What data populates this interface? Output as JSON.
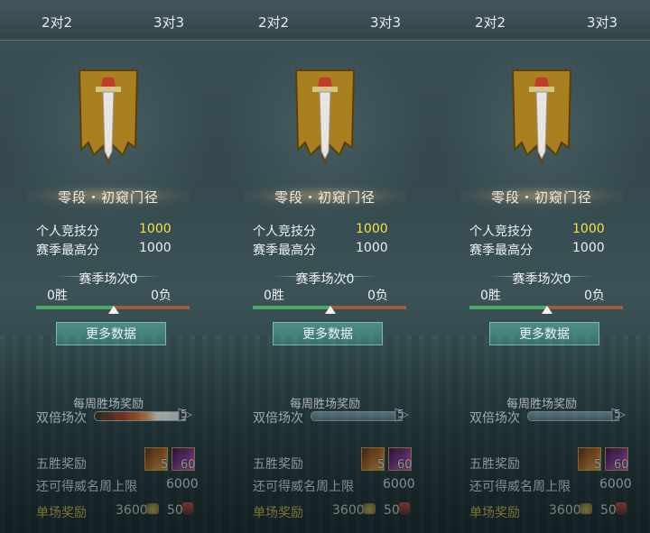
{
  "colors": {
    "gold_value": "#f4e14a",
    "reward_label": "#f2d34a",
    "win_bar": "#49a86a",
    "lose_bar": "#a05a3c"
  },
  "panels": [
    {
      "tabs": [
        {
          "label": "2对2",
          "active": false
        },
        {
          "label": "3对3",
          "active": false
        }
      ],
      "rank_name": "零段・初窥门径",
      "personal_score_label": "个人竞技分",
      "personal_score": "1000",
      "season_high_label": "赛季最高分",
      "season_high": "1000",
      "season_matches": "赛季场次0",
      "wins": "0胜",
      "losses": "0负",
      "more_data": "更多数据",
      "weekly_title": "每周胜场奖励",
      "double_label": "双倍场次",
      "double_count": "5",
      "five_wins_label": "五胜奖励",
      "item_a_count": "5",
      "item_b_count": "60",
      "remaining_label": "还可得威名周上限",
      "remaining_value": "6000",
      "single_label": "单场奖励",
      "single_coin": "3600",
      "single_badge": "50"
    },
    {
      "tabs": [
        {
          "label": "2对2",
          "active": false
        },
        {
          "label": "3对3",
          "active": true
        }
      ],
      "rank_name": "零段・初窥门径",
      "personal_score_label": "个人竞技分",
      "personal_score": "1000",
      "season_high_label": "赛季最高分",
      "season_high": "1000",
      "season_matches": "赛季场次0",
      "wins": "0胜",
      "losses": "0负",
      "more_data": "更多数据",
      "weekly_title": "每周胜场奖励",
      "double_label": "双倍场次",
      "double_count": "5",
      "five_wins_label": "五胜奖励",
      "item_a_count": "5",
      "item_b_count": "60",
      "remaining_label": "还可得威名周上限",
      "remaining_value": "6000",
      "single_label": "单场奖励",
      "single_coin": "3600",
      "single_badge": "50"
    },
    {
      "tabs": [
        {
          "label": "2对2",
          "active": false
        },
        {
          "label": "3对3",
          "active": false
        }
      ],
      "rank_name": "零段・初窥门径",
      "personal_score_label": "个人竞技分",
      "personal_score": "1000",
      "season_high_label": "赛季最高分",
      "season_high": "1000",
      "season_matches": "赛季场次0",
      "wins": "0胜",
      "losses": "0负",
      "more_data": "更多数据",
      "weekly_title": "每周胜场奖励",
      "double_label": "双倍场次",
      "double_count": "5",
      "five_wins_label": "五胜奖励",
      "item_a_count": "5",
      "item_b_count": "60",
      "remaining_label": "还可得威名周上限",
      "remaining_value": "6000",
      "single_label": "单场奖励",
      "single_coin": "3600",
      "single_badge": "50"
    }
  ]
}
